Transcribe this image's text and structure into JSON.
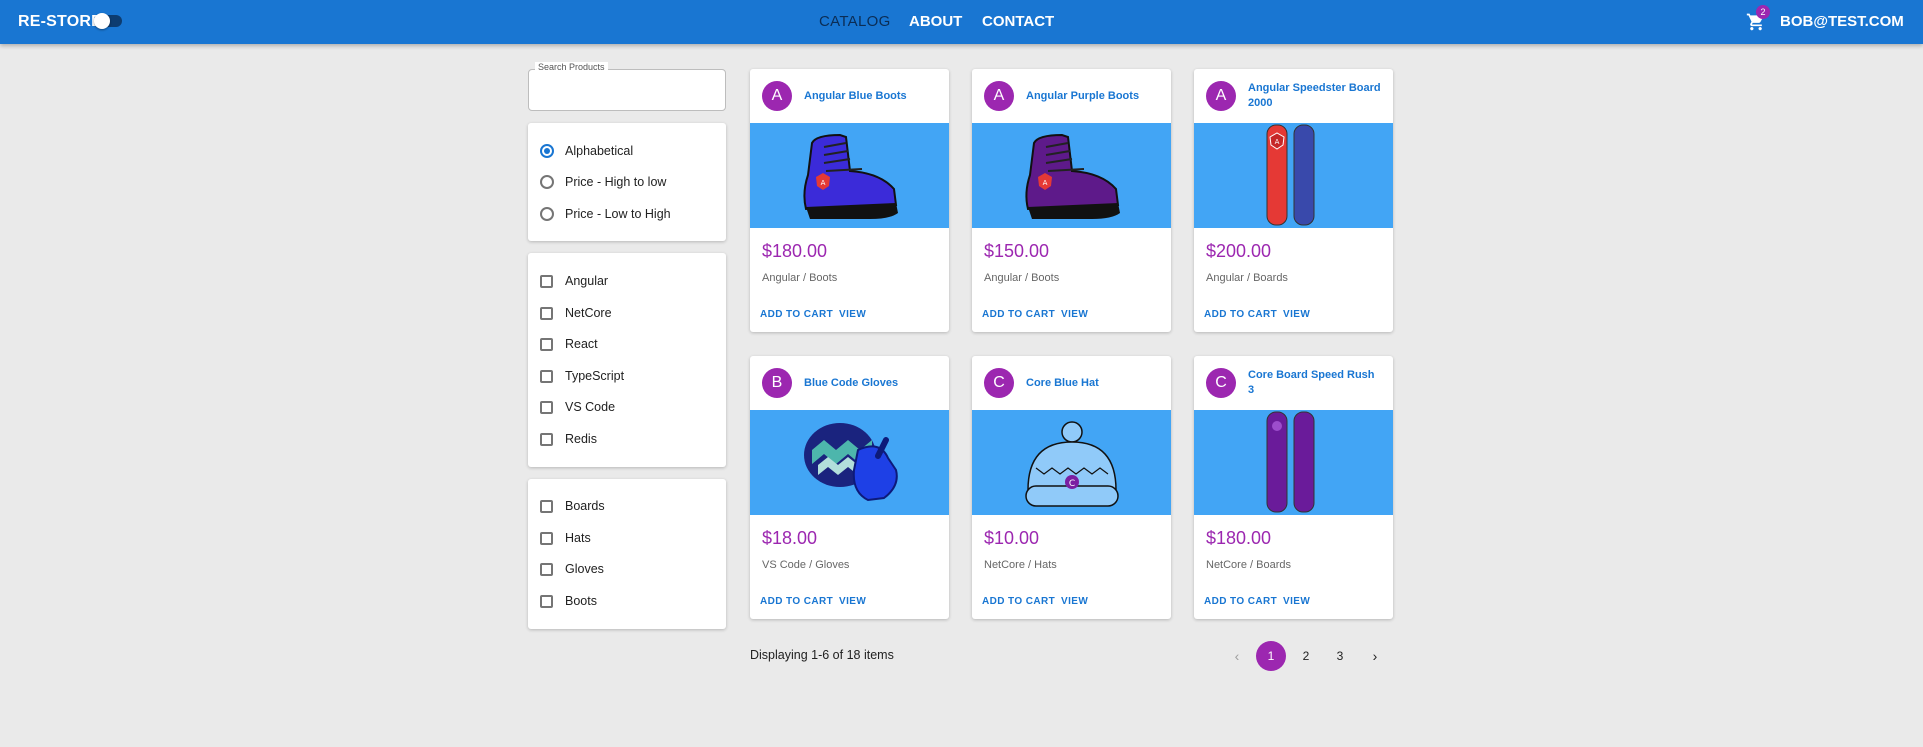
{
  "header": {
    "brand": "RE-STORE",
    "nav": [
      "CATALOG",
      "ABOUT",
      "CONTACT"
    ],
    "cart_count": "2",
    "user": "BOB@TEST.COM"
  },
  "search": {
    "label": "Search Products",
    "value": ""
  },
  "sort_options": [
    {
      "label": "Alphabetical",
      "selected": true
    },
    {
      "label": "Price - High to low",
      "selected": false
    },
    {
      "label": "Price - Low to High",
      "selected": false
    }
  ],
  "brands": [
    "Angular",
    "NetCore",
    "React",
    "TypeScript",
    "VS Code",
    "Redis"
  ],
  "types": [
    "Boards",
    "Hats",
    "Gloves",
    "Boots"
  ],
  "products": [
    {
      "initial": "A",
      "name": "Angular Blue Boots",
      "price": "$180.00",
      "category": "Angular / Boots",
      "image": "blue-boot"
    },
    {
      "initial": "A",
      "name": "Angular Purple Boots",
      "price": "$150.00",
      "category": "Angular / Boots",
      "image": "purple-boot"
    },
    {
      "initial": "A",
      "name": "Angular Speedster Board 2000",
      "price": "$200.00",
      "category": "Angular / Boards",
      "image": "red-blue-board"
    },
    {
      "initial": "B",
      "name": "Blue Code Gloves",
      "price": "$18.00",
      "category": "VS Code / Gloves",
      "image": "blue-glove"
    },
    {
      "initial": "C",
      "name": "Core Blue Hat",
      "price": "$10.00",
      "category": "NetCore / Hats",
      "image": "blue-hat"
    },
    {
      "initial": "C",
      "name": "Core Board Speed Rush 3",
      "price": "$180.00",
      "category": "NetCore / Boards",
      "image": "purple-board"
    }
  ],
  "actions": {
    "add": "ADD TO CART",
    "view": "VIEW"
  },
  "pagination": {
    "summary": "Displaying 1-6 of 18 items",
    "pages": [
      "1",
      "2",
      "3"
    ],
    "current": "1",
    "prev": "‹",
    "next": "›"
  },
  "colors": {
    "primary": "#1976d2",
    "secondary": "#9c27b0",
    "background": "#eaeaea",
    "media": "#42a5f5"
  }
}
